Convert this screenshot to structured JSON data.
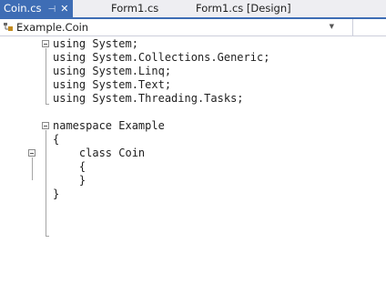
{
  "tabs": [
    {
      "label": "Coin.cs",
      "pin": "⊣",
      "close": "✕",
      "active": true
    },
    {
      "label": "Form1.cs",
      "active": false
    },
    {
      "label": "Form1.cs [Design]",
      "active": false
    }
  ],
  "navigation": {
    "type_label": "Example.Coin"
  },
  "code_lines": [
    "using System;",
    "using System.Collections.Generic;",
    "using System.Linq;",
    "using System.Text;",
    "using System.Threading.Tasks;",
    "",
    "namespace Example",
    "{",
    "    class Coin",
    "    {",
    "    }",
    "}"
  ],
  "colors": {
    "accent": "#3e6db5",
    "tab_bar_bg": "#eeeef2",
    "editor_bg": "#ffffff"
  }
}
